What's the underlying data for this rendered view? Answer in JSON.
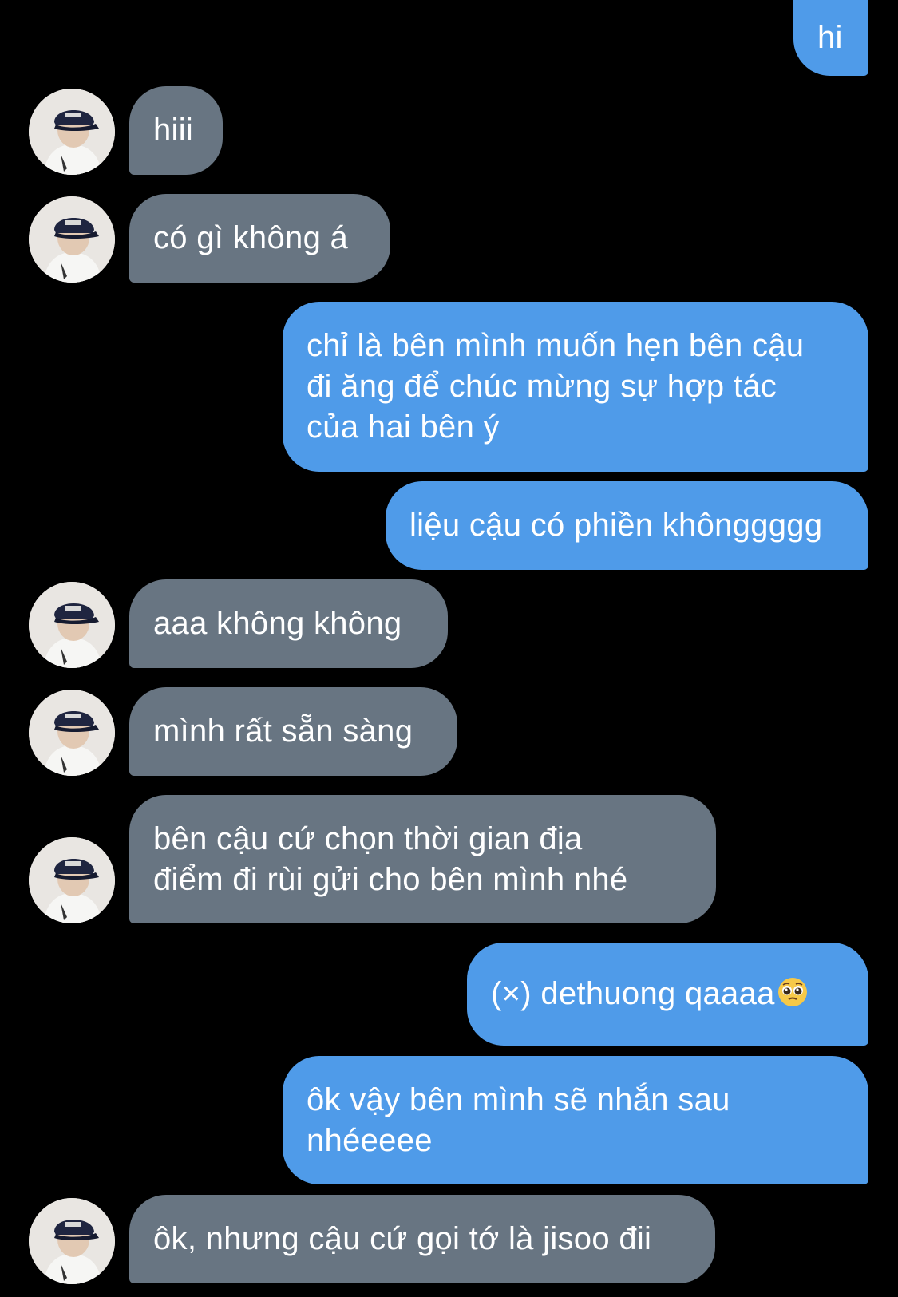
{
  "messages": [
    {
      "side": "sent",
      "text": "hi"
    },
    {
      "side": "received",
      "text": "hiii",
      "avatar": "profile-avatar-cap"
    },
    {
      "side": "received",
      "text": "có gì không á",
      "avatar": "profile-avatar-cap"
    },
    {
      "side": "sent",
      "text": "chỉ là bên mình muốn hẹn bên cậu\nđi ăng để chúc mừng sự hợp tác\ncủa hai bên ý"
    },
    {
      "side": "sent",
      "text": "liệu cậu có phiền khônggggg"
    },
    {
      "side": "received",
      "text": "aaa không không",
      "avatar": "profile-avatar-cap"
    },
    {
      "side": "received",
      "text": "mình rất sẵn sàng",
      "avatar": "profile-avatar-cap"
    },
    {
      "side": "received",
      "text": "bên cậu cứ chọn thời gian địa\nđiểm đi rùi gửi cho bên mình nhé",
      "avatar": "profile-avatar-cap"
    },
    {
      "side": "sent",
      "text": "(×) dethuong qaaaa",
      "emoji": "pleading-face-emoji"
    },
    {
      "side": "sent",
      "text": "ôk vậy bên mình sẽ nhắn sau\nnhéeeee"
    },
    {
      "side": "received",
      "text": "ôk, nhưng cậu cứ gọi tớ là jisoo đii",
      "avatar": "profile-avatar-cap"
    }
  ],
  "colors": {
    "background": "#000000",
    "sent_bubble": "#4f9be9",
    "received_bubble": "#687582",
    "text": "#ffffff"
  }
}
